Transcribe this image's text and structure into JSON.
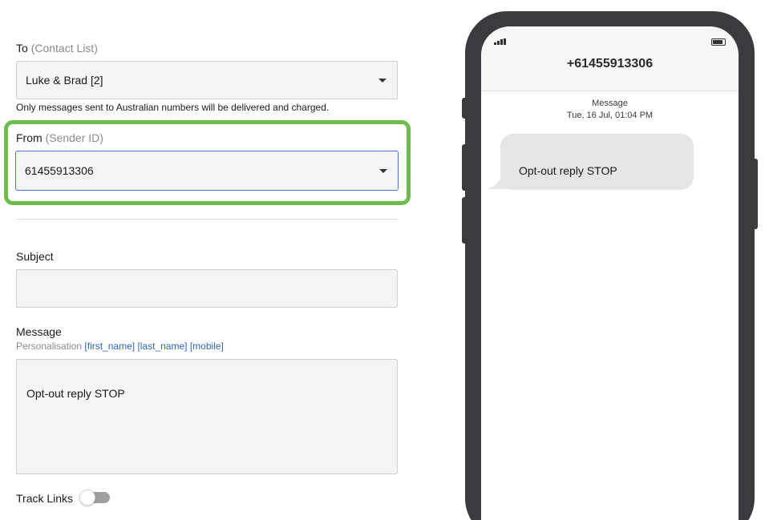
{
  "to": {
    "label": "To",
    "sublabel": "(Contact List)",
    "selected": "Luke & Brad [2]",
    "note": "Only messages sent to Australian numbers will be delivered and charged."
  },
  "from": {
    "label": "From",
    "sublabel": "(Sender ID)",
    "selected": "61455913306"
  },
  "subject": {
    "label": "Subject",
    "value": ""
  },
  "message": {
    "label": "Message",
    "personalisation_label": "Personalisation",
    "tags": [
      "[first_name]",
      "[last_name]",
      "[mobile]"
    ],
    "value": "Opt-out reply STOP"
  },
  "track_links": {
    "label": "Track Links",
    "enabled": false
  },
  "preview": {
    "phone_number": "+61455913306",
    "meta_title": "Message",
    "meta_date": "Tue, 16 Jul, 01:04 PM",
    "bubble_text": "Opt-out reply STOP"
  },
  "colors": {
    "highlight": "#6cbd4a",
    "focus_border": "#4a72d8",
    "link": "#2f65c9",
    "phone_frame": "#3b3b3f"
  },
  "icons": {
    "dropdown": "caret-down-icon",
    "signal": "signal-icon",
    "battery": "battery-icon"
  }
}
